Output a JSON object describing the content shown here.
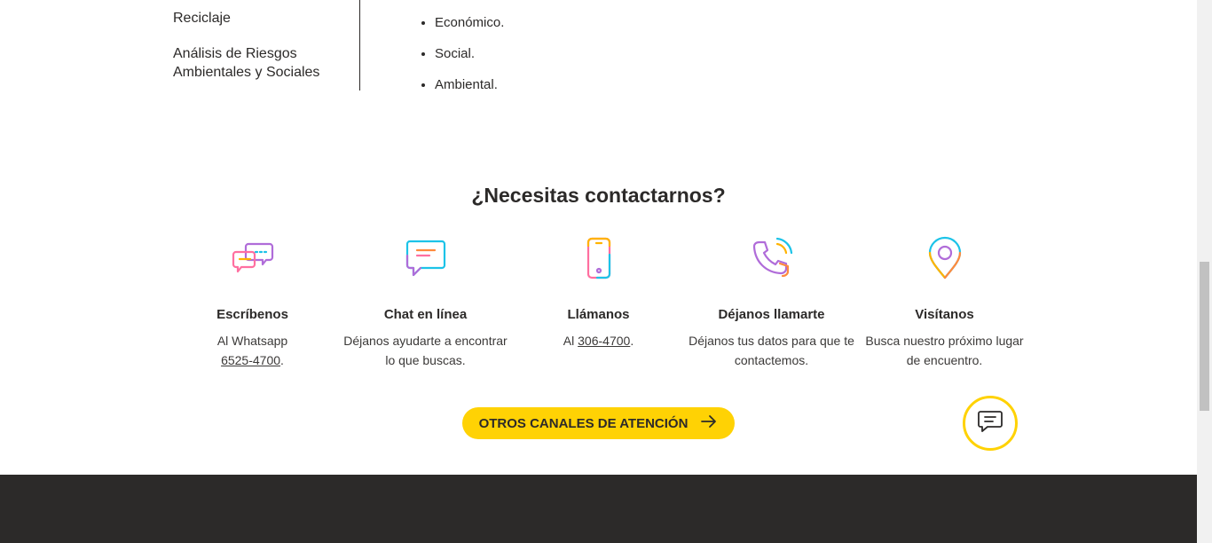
{
  "sidebar": {
    "items": [
      {
        "label": "Reciclaje"
      },
      {
        "label": "Análisis de Riesgos Ambientales y Sociales"
      }
    ]
  },
  "content": {
    "bullets": [
      "Económico.",
      "Social.",
      "Ambiental."
    ]
  },
  "contact": {
    "title": "¿Necesitas contactarnos?",
    "channels": [
      {
        "icon": "chat-bubbles-icon",
        "title": "Escríbenos",
        "text": "Al Whatsapp",
        "link": "6525-4700",
        "suffix": "."
      },
      {
        "icon": "chat-window-icon",
        "title": "Chat en línea",
        "text": "Déjanos ayudarte a encontrar lo que buscas."
      },
      {
        "icon": "mobile-phone-icon",
        "title": "Llámanos",
        "text": "Al",
        "link": "306-4700",
        "suffix": "."
      },
      {
        "icon": "phone-callback-icon",
        "title": "Déjanos llamarte",
        "text": "Déjanos tus datos para que te contactemos."
      },
      {
        "icon": "location-pin-icon",
        "title": "Visítanos",
        "text": "Busca nuestro próximo lugar de encuentro."
      }
    ],
    "cta_label": "OTROS CANALES DE ATENCIÓN"
  },
  "colors": {
    "accent": "#ffd204",
    "text": "#2c2a29",
    "footer": "#2c2a29"
  }
}
